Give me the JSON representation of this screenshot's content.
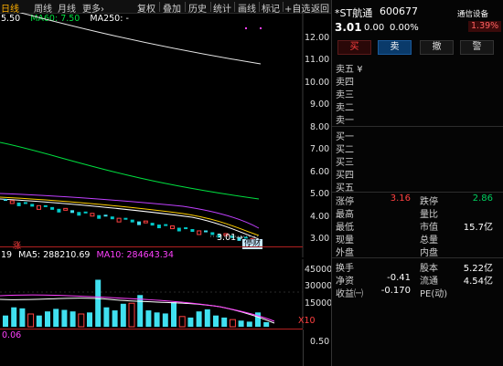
{
  "toolbar": {
    "tabs": [
      "日线",
      "周线",
      "月线",
      "更多"
    ],
    "tab_more_arrow": "›",
    "buttons": [
      "复权",
      "叠加",
      "历史",
      "统计",
      "画线",
      "标记",
      "+自选",
      "返回"
    ]
  },
  "price_chart": {
    "ma_legend": [
      {
        "text": "5.50",
        "color": "#ffffff"
      },
      {
        "text": "MA60: 7.50",
        "color": "#00e040"
      },
      {
        "text": "MA250: -",
        "color": "#ffffff"
      }
    ],
    "y_labels": [
      "12.00",
      "11.00",
      "10.00",
      "9.00",
      "8.00",
      "7.00",
      "6.00",
      "5.00",
      "4.00",
      "3.00"
    ],
    "last_price_label": "3.01",
    "last_price_arrow": "→",
    "rise_marker": "涨",
    "suspend_badge": "停财"
  },
  "volume_chart": {
    "legend_prefix": "19",
    "ma5": "MA5: 288210.69",
    "ma10": "MA10: 284643.34",
    "y_labels": [
      "45000",
      "30000",
      "15000"
    ],
    "unit": "X10",
    "bars": [
      0.22,
      0.38,
      0.36,
      0.25,
      0.22,
      0.3,
      0.35,
      0.33,
      0.3,
      0.25,
      0.28,
      0.92,
      0.38,
      0.32,
      0.45,
      0.46,
      0.62,
      0.32,
      0.28,
      0.26,
      0.48,
      0.2,
      0.18,
      0.3,
      0.34,
      0.22,
      0.18,
      0.14,
      0.12,
      0.1,
      0.28,
      0.09
    ]
  },
  "macd": {
    "label": "0.06",
    "y_label": "0.50"
  },
  "stock": {
    "name": "*ST航通",
    "code": "600677",
    "sector": "通信设备",
    "sector_change": "1.39%",
    "price": "3.01",
    "change": "0.00",
    "change_pct": "0.00%"
  },
  "actions": [
    "买",
    "卖",
    "撤",
    "警"
  ],
  "order_book": {
    "sell_labels": [
      "卖五",
      "卖四",
      "卖三",
      "卖二",
      "卖一"
    ],
    "sell5_extra": "¥",
    "buy_labels": [
      "买一",
      "买二",
      "买三",
      "买四",
      "买五"
    ]
  },
  "stats": {
    "limit_up_label": "涨停",
    "limit_up": "3.16",
    "limit_down_label": "跌停",
    "limit_down": "2.86",
    "high_label": "最高",
    "vol_ratio_label": "量比",
    "low_label": "最低",
    "mktcap_label": "市值",
    "mktcap": "15.7亿",
    "current_vol_label": "现量",
    "total_vol_label": "总量",
    "outer_label": "外盘",
    "inner_label": "内盘",
    "turnover_label": "换手",
    "share_cap_label": "股本",
    "share_cap": "5.22亿",
    "net_assets_label": "净资",
    "net_assets": "-0.41",
    "float_label": "流通",
    "float_cap": "4.54亿",
    "eps_label": "收益㈠",
    "eps": "-0.170",
    "pe_label": "PE(动)"
  },
  "colors": {
    "up": "#ff4040",
    "down": "#00c060",
    "cyan": "#40e0f0",
    "ma60": "#00e040",
    "purple": "#c040ff",
    "accent": "#ffb000"
  }
}
